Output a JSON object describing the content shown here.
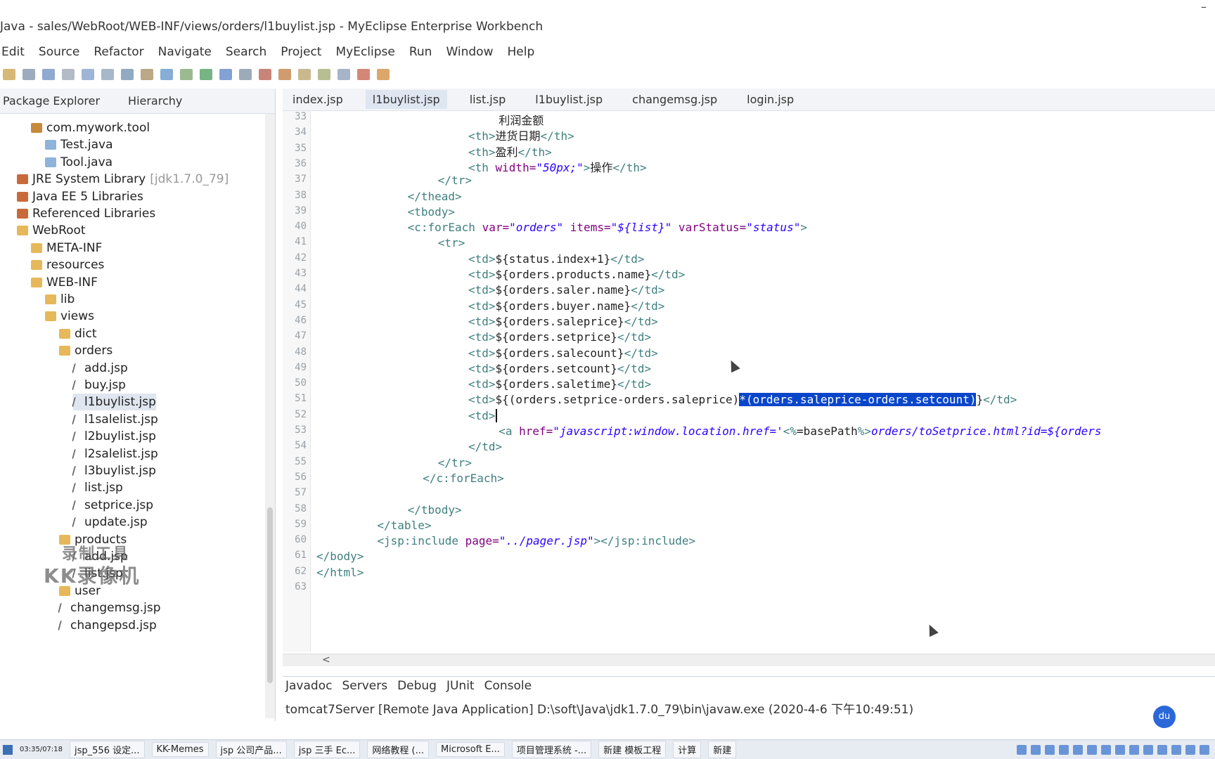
{
  "window": {
    "title": "Java - sales/WebRoot/WEB-INF/views/orders/l1buylist.jsp - MyEclipse Enterprise Workbench",
    "minimize": "–"
  },
  "menu": [
    "Edit",
    "Source",
    "Refactor",
    "Navigate",
    "Search",
    "Project",
    "MyEclipse",
    "Run",
    "Window",
    "Help"
  ],
  "left_tabs": [
    "Package Explorer",
    "Hierarchy"
  ],
  "tree": [
    {
      "label": "com.mywork.tool",
      "icon": "package",
      "indent": 2
    },
    {
      "label": "Test.java",
      "icon": "java",
      "indent": 3
    },
    {
      "label": "Tool.java",
      "icon": "java",
      "indent": 3
    },
    {
      "label": "JRE System Library",
      "suffix": "[jdk1.7.0_79]",
      "icon": "library",
      "indent": 1
    },
    {
      "label": "Java EE 5 Libraries",
      "icon": "library",
      "indent": 1
    },
    {
      "label": "Referenced Libraries",
      "icon": "library",
      "indent": 1
    },
    {
      "label": "WebRoot",
      "icon": "folder",
      "indent": 1
    },
    {
      "label": "META-INF",
      "icon": "folder",
      "indent": 2
    },
    {
      "label": "resources",
      "icon": "folder",
      "indent": 2
    },
    {
      "label": "WEB-INF",
      "icon": "folder",
      "indent": 2
    },
    {
      "label": "lib",
      "icon": "folder",
      "indent": 3
    },
    {
      "label": "views",
      "icon": "folder",
      "indent": 3
    },
    {
      "label": "dict",
      "icon": "folder",
      "indent": 4
    },
    {
      "label": "orders",
      "icon": "folder",
      "indent": 4
    },
    {
      "label": "add.jsp",
      "icon": "jsp",
      "indent": 5
    },
    {
      "label": "buy.jsp",
      "icon": "jsp",
      "indent": 5
    },
    {
      "label": "l1buylist.jsp",
      "icon": "jsp",
      "indent": 5,
      "selected": true
    },
    {
      "label": "l1salelist.jsp",
      "icon": "jsp",
      "indent": 5
    },
    {
      "label": "l2buylist.jsp",
      "icon": "jsp",
      "indent": 5
    },
    {
      "label": "l2salelist.jsp",
      "icon": "jsp",
      "indent": 5
    },
    {
      "label": "l3buylist.jsp",
      "icon": "jsp",
      "indent": 5
    },
    {
      "label": "list.jsp",
      "icon": "jsp",
      "indent": 5
    },
    {
      "label": "setprice.jsp",
      "icon": "jsp",
      "indent": 5
    },
    {
      "label": "update.jsp",
      "icon": "jsp",
      "indent": 5
    },
    {
      "label": "products",
      "icon": "folder",
      "indent": 4
    },
    {
      "label": "add.jsp",
      "icon": "jsp",
      "indent": 5
    },
    {
      "label": "list.jsp",
      "icon": "jsp",
      "indent": 5
    },
    {
      "label": "user",
      "icon": "folder",
      "indent": 4
    },
    {
      "label": "changemsg.jsp",
      "icon": "jsp",
      "indent": 4
    },
    {
      "label": "changepsd.jsp",
      "icon": "jsp",
      "indent": 4
    }
  ],
  "watermark": {
    "line1": "录制工具",
    "line2": "KK录像机"
  },
  "editor_tabs": [
    {
      "label": "index.jsp",
      "active": false
    },
    {
      "label": "l1buylist.jsp",
      "active": true
    },
    {
      "label": "list.jsp",
      "active": false
    },
    {
      "label": "l1buylist.jsp",
      "active": false
    },
    {
      "label": "changemsg.jsp",
      "active": false
    },
    {
      "label": "login.jsp",
      "active": false
    }
  ],
  "code_lines": [
    {
      "ln": "33",
      "indent": 24,
      "segments": [
        {
          "c": "el",
          "t": "利润金额"
        }
      ]
    },
    {
      "ln": "34",
      "indent": 20,
      "segments": [
        {
          "c": "tag",
          "t": "<th>"
        },
        {
          "c": "el",
          "t": "进货日期"
        },
        {
          "c": "tag",
          "t": "</th>"
        }
      ]
    },
    {
      "ln": "35",
      "indent": 20,
      "segments": [
        {
          "c": "tag",
          "t": "<th>"
        },
        {
          "c": "el",
          "t": "盈利"
        },
        {
          "c": "tag",
          "t": "</th>"
        }
      ]
    },
    {
      "ln": "36",
      "indent": 20,
      "segments": [
        {
          "c": "tag",
          "t": "<th "
        },
        {
          "c": "attr",
          "t": "width="
        },
        {
          "c": "str",
          "t": "\"50px;\""
        },
        {
          "c": "tag",
          "t": ">"
        },
        {
          "c": "el",
          "t": "操作"
        },
        {
          "c": "tag",
          "t": "</th>"
        }
      ]
    },
    {
      "ln": "37",
      "indent": 16,
      "segments": [
        {
          "c": "tag",
          "t": "</tr>"
        }
      ]
    },
    {
      "ln": "38",
      "indent": 12,
      "segments": [
        {
          "c": "tag",
          "t": "</thead>"
        }
      ]
    },
    {
      "ln": "39",
      "indent": 12,
      "segments": [
        {
          "c": "tag",
          "t": "<tbody>"
        }
      ]
    },
    {
      "ln": "40",
      "indent": 12,
      "segments": [
        {
          "c": "tag",
          "t": "<c:forEach "
        },
        {
          "c": "attr",
          "t": "var="
        },
        {
          "c": "str",
          "t": "\"orders\""
        },
        {
          "c": "attr",
          "t": " items="
        },
        {
          "c": "str",
          "t": "\"${list}\""
        },
        {
          "c": "attr",
          "t": " varStatus="
        },
        {
          "c": "str",
          "t": "\"status\""
        },
        {
          "c": "tag",
          "t": ">"
        }
      ]
    },
    {
      "ln": "41",
      "indent": 16,
      "segments": [
        {
          "c": "tag",
          "t": "<tr>"
        }
      ]
    },
    {
      "ln": "42",
      "indent": 20,
      "segments": [
        {
          "c": "tag",
          "t": "<td>"
        },
        {
          "c": "el",
          "t": "${status.index+1}"
        },
        {
          "c": "tag",
          "t": "</td>"
        }
      ]
    },
    {
      "ln": "43",
      "indent": 20,
      "segments": [
        {
          "c": "tag",
          "t": "<td>"
        },
        {
          "c": "el",
          "t": "${orders.products.name}"
        },
        {
          "c": "tag",
          "t": "</td>"
        }
      ]
    },
    {
      "ln": "44",
      "indent": 20,
      "segments": [
        {
          "c": "tag",
          "t": "<td>"
        },
        {
          "c": "el",
          "t": "${orders.saler.name}"
        },
        {
          "c": "tag",
          "t": "</td>"
        }
      ]
    },
    {
      "ln": "45",
      "indent": 20,
      "segments": [
        {
          "c": "tag",
          "t": "<td>"
        },
        {
          "c": "el",
          "t": "${orders.buyer.name}"
        },
        {
          "c": "tag",
          "t": "</td>"
        }
      ]
    },
    {
      "ln": "46",
      "indent": 20,
      "segments": [
        {
          "c": "tag",
          "t": "<td>"
        },
        {
          "c": "el",
          "t": "${orders.saleprice}"
        },
        {
          "c": "tag",
          "t": "</td>"
        }
      ]
    },
    {
      "ln": "47",
      "indent": 20,
      "segments": [
        {
          "c": "tag",
          "t": "<td>"
        },
        {
          "c": "el",
          "t": "${orders.setprice}"
        },
        {
          "c": "tag",
          "t": "</td>"
        }
      ]
    },
    {
      "ln": "48",
      "indent": 20,
      "segments": [
        {
          "c": "tag",
          "t": "<td>"
        },
        {
          "c": "el",
          "t": "${orders.salecount}"
        },
        {
          "c": "tag",
          "t": "</td>"
        }
      ]
    },
    {
      "ln": "49",
      "indent": 20,
      "segments": [
        {
          "c": "tag",
          "t": "<td>"
        },
        {
          "c": "el",
          "t": "${orders.setcount}"
        },
        {
          "c": "tag",
          "t": "</td>"
        }
      ]
    },
    {
      "ln": "50",
      "indent": 20,
      "segments": [
        {
          "c": "tag",
          "t": "<td>"
        },
        {
          "c": "el",
          "t": "${orders.saletime}"
        },
        {
          "c": "tag",
          "t": "</td>"
        }
      ]
    },
    {
      "ln": "51",
      "indent": 20,
      "segments": [
        {
          "c": "tag",
          "t": "<td>"
        },
        {
          "c": "el",
          "t": "${(orders.setprice-orders.saleprice)"
        },
        {
          "c": "hl",
          "t": "*(orders.saleprice-orders.setcount)"
        },
        {
          "c": "el",
          "t": "}"
        },
        {
          "c": "tag",
          "t": "</td>"
        }
      ]
    },
    {
      "ln": "52",
      "indent": 20,
      "segments": [
        {
          "c": "tag",
          "t": "<td>"
        },
        {
          "c": "cursor",
          "t": ""
        }
      ]
    },
    {
      "ln": "53",
      "indent": 24,
      "segments": [
        {
          "c": "tag",
          "t": "<a "
        },
        {
          "c": "attr",
          "t": "href="
        },
        {
          "c": "str",
          "t": "\"javascript:window.location.href='"
        },
        {
          "c": "tag",
          "t": "<%"
        },
        {
          "c": "el",
          "t": "=basePath"
        },
        {
          "c": "tag",
          "t": "%>"
        },
        {
          "c": "str",
          "t": "orders/toSetprice.html?id=${orders"
        }
      ]
    },
    {
      "ln": "54",
      "indent": 20,
      "segments": [
        {
          "c": "tag",
          "t": "</td>"
        }
      ]
    },
    {
      "ln": "55",
      "indent": 16,
      "segments": [
        {
          "c": "tag",
          "t": "</tr>"
        }
      ]
    },
    {
      "ln": "56",
      "indent": 14,
      "segments": [
        {
          "c": "tag",
          "t": "</c:forEach>"
        }
      ]
    },
    {
      "ln": "57",
      "indent": 0,
      "segments": []
    },
    {
      "ln": "58",
      "indent": 12,
      "segments": [
        {
          "c": "tag",
          "t": "</tbody>"
        }
      ]
    },
    {
      "ln": "59",
      "indent": 8,
      "segments": [
        {
          "c": "tag",
          "t": "</table>"
        }
      ]
    },
    {
      "ln": "60",
      "indent": 8,
      "segments": [
        {
          "c": "tag",
          "t": "<jsp:include "
        },
        {
          "c": "attr",
          "t": "page="
        },
        {
          "c": "str",
          "t": "\"../pager.jsp\""
        },
        {
          "c": "tag",
          "t": "></jsp:include>"
        }
      ]
    },
    {
      "ln": "61",
      "indent": 0,
      "segments": [
        {
          "c": "tag",
          "t": "</body>"
        }
      ]
    },
    {
      "ln": "62",
      "indent": 0,
      "segments": [
        {
          "c": "tag",
          "t": "</html>"
        }
      ]
    },
    {
      "ln": "63",
      "indent": 0,
      "segments": []
    }
  ],
  "bottom_tabs": [
    "Javadoc",
    "Servers",
    "Debug",
    "JUnit",
    "Console"
  ],
  "console_status": "tomcat7Server [Remote Java Application] D:\\soft\\Java\\jdk1.7.0_79\\bin\\javaw.exe (2020-4-6 下午10:49:51)",
  "taskbar": {
    "items": [
      "jsp_556 设定...",
      "KK-Memes",
      "jsp 公司产品...",
      "jsp 三手 Ec...",
      "网络教程 (...",
      "Microsoft E...",
      "项目管理系统 -...",
      "新建 模板工程",
      "计算",
      "新建"
    ],
    "clock": "03:35/07:18"
  },
  "ime_label": "du"
}
